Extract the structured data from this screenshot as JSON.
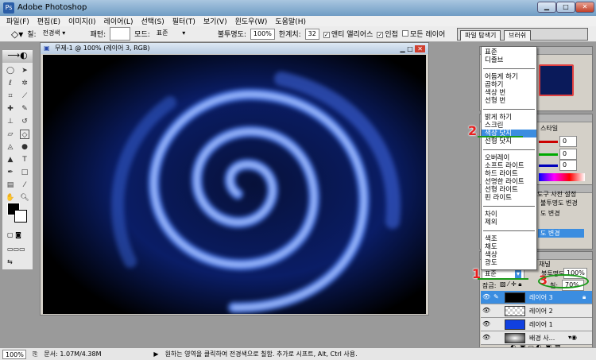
{
  "app": {
    "title": "Adobe Photoshop"
  },
  "menu": [
    "파일(F)",
    "편집(E)",
    "이미지(I)",
    "레이어(L)",
    "선택(S)",
    "필터(T)",
    "보기(V)",
    "윈도우(W)",
    "도움말(H)"
  ],
  "options": {
    "fill_label": "칠:",
    "fill_value": "전경색",
    "pattern_label": "패턴:",
    "mode_label": "모드:",
    "mode_value": "표준",
    "opacity_label": "불투명도:",
    "opacity_value": "100%",
    "tolerance_label": "한계치:",
    "tolerance_value": "32",
    "antialias": "앤티 앨리어스",
    "contiguous": "인접",
    "all_layers": "모든 레이어"
  },
  "palette_well": {
    "tabs": [
      "파일 탐색기",
      "브러쉬"
    ]
  },
  "document": {
    "title": "무제-1 @ 100% (레이어 3, RGB)"
  },
  "blend_menu": {
    "groups": [
      [
        "표준",
        "디졸브"
      ],
      [
        "어둡게 하기",
        "곱하기",
        "색상 번",
        "선형 번"
      ],
      [
        "밝게 하기",
        "스크린",
        "색상 닷지",
        "선형 닷지"
      ],
      [
        "오버레이",
        "소프트 라이트",
        "하드 라이트",
        "선명한 라이트",
        "선형 라이트",
        "핀 라이트"
      ],
      [
        "차이",
        "제외"
      ],
      [
        "색조",
        "채도",
        "색상",
        "광도"
      ]
    ],
    "selected": "색상 닷지"
  },
  "color_panel": {
    "tab": "스타일",
    "r": "0",
    "g": "0",
    "b": "0"
  },
  "history_panel": {
    "tab": "도구 사전 설정",
    "items": [
      "불투명도 변경",
      "도 변경",
      "도 변경"
    ]
  },
  "layers_panel": {
    "tab": "채널",
    "mode": "표준",
    "opacity_label": "불투명도:",
    "opacity": "100%",
    "lock_label": "잠금:",
    "fill_label": "칠:",
    "fill": "70%",
    "layers": [
      {
        "name": "레이어 3"
      },
      {
        "name": "레이어 2"
      },
      {
        "name": "레이어 1"
      },
      {
        "name": "배경 사..."
      }
    ]
  },
  "annotations": [
    "1",
    "2",
    "3"
  ],
  "status": {
    "zoom": "100%",
    "doc": "문서: 1.07M/4.38M",
    "hint": "원하는 영역을 클릭하여 전경색으로 칠함. 추가로 시프트, Alt, Ctrl 사용."
  },
  "colors": {
    "accent": "#3b8de0",
    "annotation_red": "#e82020",
    "annotation_green": "#1a9a1a",
    "layer_blue": "#1040e0"
  }
}
